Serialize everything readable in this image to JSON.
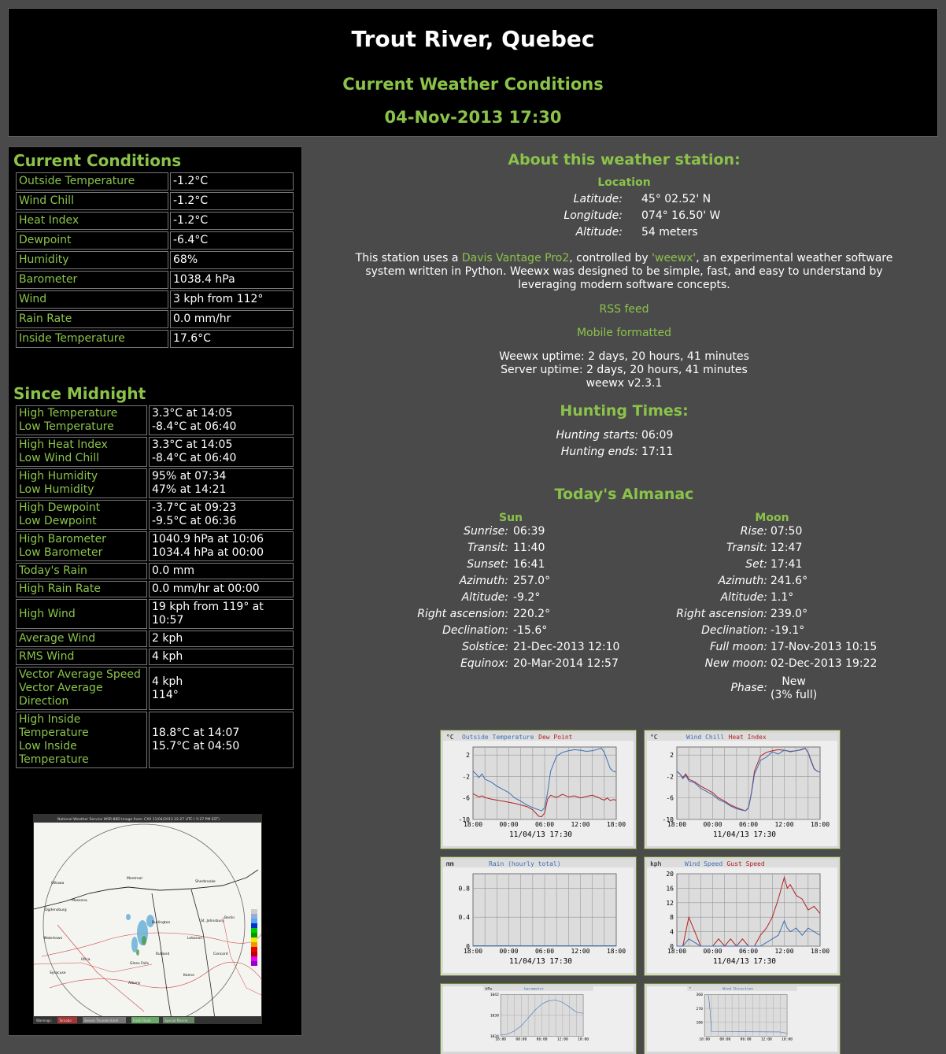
{
  "header": {
    "title": "Trout River, Quebec",
    "subtitle": "Current Weather Conditions",
    "time": "04-Nov-2013 17:30"
  },
  "current": {
    "title": "Current Conditions",
    "rows": [
      {
        "label": "Outside Temperature",
        "value": "-1.2°C"
      },
      {
        "label": "Wind Chill",
        "value": "-1.2°C"
      },
      {
        "label": "Heat Index",
        "value": "-1.2°C"
      },
      {
        "label": "Dewpoint",
        "value": "-6.4°C"
      },
      {
        "label": "Humidity",
        "value": "68%"
      },
      {
        "label": "Barometer",
        "value": "1038.4 hPa"
      },
      {
        "label": "Wind",
        "value": "3 kph from 112°"
      },
      {
        "label": "Rain Rate",
        "value": "0.0 mm/hr"
      },
      {
        "label": "Inside Temperature",
        "value": "17.6°C"
      }
    ]
  },
  "since": {
    "title": "Since Midnight",
    "rows": [
      {
        "l1": "High Temperature",
        "l2": "Low Temperature",
        "v1": "3.3°C at 14:05",
        "v2": "-8.4°C at 06:40"
      },
      {
        "l1": "High Heat Index",
        "l2": "Low Wind Chill",
        "v1": "3.3°C at 14:05",
        "v2": "-8.4°C at 06:40"
      },
      {
        "l1": "High Humidity",
        "l2": "Low Humidity",
        "v1": "95% at 07:34",
        "v2": "47% at 14:21"
      },
      {
        "l1": "High Dewpoint",
        "l2": "Low Dewpoint",
        "v1": "-3.7°C at 09:23",
        "v2": "-9.5°C at 06:36"
      },
      {
        "l1": "High Barometer",
        "l2": "Low Barometer",
        "v1": "1040.9 hPa at 10:06",
        "v2": "1034.4 hPa at 00:00"
      },
      {
        "l1": "Today's Rain",
        "v1": "0.0 mm"
      },
      {
        "l1": "High Rain Rate",
        "v1": "0.0 mm/hr at 00:00"
      },
      {
        "l1": "High Wind",
        "v1": "19 kph from 119° at",
        "v2": "10:57"
      },
      {
        "l1": "Average Wind",
        "v1": "2 kph"
      },
      {
        "l1": "RMS Wind",
        "v1": "4 kph"
      },
      {
        "l1": "Vector Average Speed",
        "l2": "Vector Average",
        "l3": "Direction",
        "v1": "4 kph",
        "v2": "114°"
      },
      {
        "l1": "High Inside",
        "l2": "Temperature",
        "l3": "Low Inside Temperature",
        "v1": "18.8°C at 14:07",
        "v2": "15.7°C at 04:50"
      }
    ]
  },
  "radar": {
    "caption": "National Weather Service WSR-88D Image from: CXX 11/04/2013 22:27 UTC ( 5:27 PM EST)",
    "legend": [
      "Warnings:",
      "Tornado",
      "Severe Thunderstorm",
      "Flash Flood",
      "Special Marine"
    ],
    "places": [
      "Montreal",
      "Ottawa",
      "Sherbrooke",
      "Massena",
      "Burlington",
      "Ogdensburg",
      "Watertown",
      "Glens Falls",
      "Rutland",
      "Lebanon",
      "Concord",
      "Albany",
      "Keene",
      "Syracuse",
      "Utica",
      "St. Johnsbury",
      "Berlin"
    ]
  },
  "about": {
    "title": "About this weather station:",
    "location_title": "Location",
    "latitude_label": "Latitude:",
    "latitude": "45° 02.52' N",
    "longitude_label": "Longitude:",
    "longitude": "074° 16.50' W",
    "altitude_label": "Altitude:",
    "altitude": "54 meters",
    "desc_1": "This station uses a ",
    "link_davis": "Davis Vantage Pro2",
    "desc_2": ", controlled by ",
    "link_weewx": "'weewx'",
    "desc_3": ", an experimental weather software",
    "desc_line2": "system written in Python. Weewx was designed to be simple, fast, and easy to understand by",
    "desc_line3": "leveraging modern software concepts.",
    "rss": "RSS feed",
    "mobile": "Mobile formatted",
    "weewx_uptime": "Weewx uptime: 2 days, 20 hours, 41 minutes",
    "server_uptime": "Server uptime: 2 days, 20 hours, 41 minutes",
    "version": "weewx v2.3.1"
  },
  "hunting": {
    "title": "Hunting Times:",
    "start_label": "Hunting starts:",
    "start": "06:09",
    "end_label": "Hunting ends:",
    "end": "17:11"
  },
  "almanac": {
    "title": "Today's Almanac",
    "sun_title": "Sun",
    "moon_title": "Moon",
    "sun": [
      {
        "k": "Sunrise:",
        "v": "06:39"
      },
      {
        "k": "Transit:",
        "v": "11:40"
      },
      {
        "k": "Sunset:",
        "v": "16:41"
      },
      {
        "k": "Azimuth:",
        "v": "257.0°"
      },
      {
        "k": "Altitude:",
        "v": "-9.2°"
      },
      {
        "k": "Right ascension:",
        "v": "220.2°"
      },
      {
        "k": "Declination:",
        "v": "-15.6°"
      },
      {
        "k": "Solstice:",
        "v": "21-Dec-2013 12:10"
      },
      {
        "k": "Equinox:",
        "v": "20-Mar-2014 12:57"
      }
    ],
    "moon": [
      {
        "k": "Rise:",
        "v": "07:50"
      },
      {
        "k": "Transit:",
        "v": "12:47"
      },
      {
        "k": "Set:",
        "v": "17:41"
      },
      {
        "k": "Azimuth:",
        "v": "241.6°"
      },
      {
        "k": "Altitude:",
        "v": "1.1°"
      },
      {
        "k": "Right ascension:",
        "v": "239.0°"
      },
      {
        "k": "Declination:",
        "v": "-19.1°"
      },
      {
        "k": "Full moon:",
        "v": "17-Nov-2013 10:15"
      },
      {
        "k": "New moon:",
        "v": "02-Dec-2013 19:22"
      }
    ],
    "phase_label": "Phase:",
    "phase_1": "New",
    "phase_2": "(3% full)"
  },
  "colors": {
    "accent": "#8bc34a",
    "background": "#4a4a4a",
    "panel": "#000000",
    "series_blue": "#3b6fb6",
    "series_red": "#b22222"
  },
  "chart_data": [
    {
      "type": "line",
      "unit": "°C",
      "series_names": [
        "Outside Temperature",
        "Dew Point"
      ],
      "xticks": [
        "18:00",
        "00:00",
        "06:00",
        "12:00",
        "18:00"
      ],
      "xlabel": "11/04/13 17:30",
      "yticks": [
        2,
        -2,
        -6,
        -10
      ],
      "ylim": [
        -10,
        3.5
      ],
      "x": [
        0,
        0.5,
        1,
        1.5,
        2,
        3,
        4,
        5,
        6,
        7,
        8,
        9,
        10,
        11,
        11.5,
        12,
        12.5,
        13,
        14,
        15,
        16,
        17,
        18,
        19,
        20,
        21,
        21.5,
        22,
        22.5,
        23,
        23.5,
        24
      ],
      "series": [
        {
          "name": "Outside Temperature",
          "color": "blue",
          "values": [
            -1,
            -1.5,
            -2.2,
            -1.5,
            -2.5,
            -3,
            -3.8,
            -4.4,
            -5,
            -6,
            -6.6,
            -7.3,
            -7.8,
            -8.2,
            -8.4,
            -7.8,
            -5,
            -1,
            1.8,
            2.5,
            2.8,
            3,
            2.9,
            2.7,
            2.8,
            3.1,
            3.3,
            2.5,
            1,
            -0.5,
            -1,
            -1.2
          ]
        },
        {
          "name": "Dew Point",
          "color": "red",
          "values": [
            -5.2,
            -5.5,
            -5.8,
            -5.6,
            -5.9,
            -6.2,
            -6.4,
            -6.6,
            -6.8,
            -7,
            -7.3,
            -7.6,
            -8.2,
            -9.4,
            -9.5,
            -8.8,
            -6.2,
            -5.5,
            -5.9,
            -5.3,
            -5.8,
            -5.6,
            -6,
            -5.7,
            -5.5,
            -5.9,
            -6.2,
            -6.4,
            -6.0,
            -6.5,
            -6.3,
            -6.4
          ]
        }
      ]
    },
    {
      "type": "line",
      "unit": "°C",
      "series_names": [
        "Wind Chill",
        "Heat Index"
      ],
      "xticks": [
        "18:00",
        "00:00",
        "06:00",
        "12:00",
        "18:00"
      ],
      "xlabel": "11/04/13 17:30",
      "yticks": [
        2,
        -2,
        -6,
        -10
      ],
      "ylim": [
        -10,
        3.5
      ],
      "x": [
        0,
        0.5,
        1,
        1.5,
        2,
        3,
        4,
        5,
        6,
        7,
        8,
        9,
        10,
        11,
        11.5,
        12,
        12.5,
        13,
        14,
        15,
        16,
        17,
        18,
        19,
        20,
        21,
        21.5,
        22,
        22.5,
        23,
        23.5,
        24
      ],
      "series": [
        {
          "name": "Heat Index",
          "color": "red",
          "values": [
            -1,
            -1.5,
            -2.2,
            -1.5,
            -2.5,
            -3,
            -3.8,
            -4.4,
            -5,
            -6,
            -6.6,
            -7.3,
            -7.8,
            -8.2,
            -8.4,
            -7.8,
            -5,
            -1,
            1.8,
            2.5,
            2.8,
            3,
            2.9,
            2.7,
            2.8,
            3.1,
            3.3,
            2.5,
            1,
            -0.5,
            -1,
            -1.2
          ]
        },
        {
          "name": "Wind Chill",
          "color": "blue",
          "values": [
            -1,
            -1.5,
            -2.4,
            -1.8,
            -2.8,
            -3.2,
            -4.2,
            -4.8,
            -5.4,
            -6.3,
            -6.8,
            -7.5,
            -8,
            -8.3,
            -8.4,
            -7.9,
            -5.2,
            -1.6,
            1,
            1.6,
            2.6,
            2.2,
            2.9,
            2.6,
            2.8,
            3.0,
            3.3,
            2.4,
            0.8,
            -0.6,
            -1,
            -1.2
          ]
        }
      ]
    },
    {
      "type": "bar",
      "unit": "mm",
      "series_names": [
        "Rain (hourly total)"
      ],
      "xticks": [
        "18:00",
        "00:00",
        "06:00",
        "12:00",
        "18:00"
      ],
      "xlabel": "11/04/13 17:30",
      "yticks": [
        0.8,
        0.4,
        0.0
      ],
      "ylim": [
        0,
        1.0
      ],
      "x": [
        0,
        24
      ],
      "series": [
        {
          "name": "Rain (hourly total)",
          "color": "blue",
          "values": [
            0,
            0
          ]
        }
      ]
    },
    {
      "type": "line",
      "unit": "kph",
      "series_names": [
        "Wind Speed",
        "Gust Speed"
      ],
      "xticks": [
        "18:00",
        "00:00",
        "06:00",
        "12:00",
        "18:00"
      ],
      "xlabel": "11/04/13 17:30",
      "yticks": [
        20,
        16,
        12,
        8,
        4,
        0
      ],
      "ylim": [
        0,
        20
      ],
      "x": [
        0,
        0.5,
        1,
        1.5,
        2,
        3,
        4,
        5,
        6,
        7,
        8,
        9,
        10,
        11,
        12,
        13,
        14,
        15,
        16,
        17,
        18,
        18.5,
        19,
        20,
        21,
        22,
        23,
        24
      ],
      "series": [
        {
          "name": "Gust Speed",
          "color": "red",
          "values": [
            0,
            0,
            0,
            4,
            8,
            4,
            0,
            0,
            0,
            2,
            0,
            2,
            0,
            2,
            0,
            0,
            3,
            5,
            8,
            13,
            19,
            16,
            17,
            14,
            13,
            10,
            11,
            9
          ]
        },
        {
          "name": "Wind Speed",
          "color": "blue",
          "values": [
            0,
            0,
            0,
            1,
            2,
            1,
            0,
            0,
            0,
            0,
            0,
            0,
            0,
            0,
            0,
            0,
            0,
            1,
            2,
            3,
            7,
            5,
            4,
            5,
            3,
            5,
            4,
            3
          ]
        }
      ]
    },
    {
      "type": "line",
      "unit": "hPa",
      "series_names": [
        "barometer"
      ],
      "xticks": [
        "18:00",
        "00:00",
        "06:00",
        "12:00",
        "18:00"
      ],
      "yticks": [
        1042,
        1038,
        1034
      ],
      "ylim": [
        1034,
        1042
      ],
      "x": [
        0,
        2,
        4,
        6,
        8,
        10,
        12,
        14,
        16,
        18,
        20,
        22,
        24
      ],
      "series": [
        {
          "name": "barometer",
          "color": "blue",
          "values": [
            1034.2,
            1034.4,
            1035,
            1036,
            1037.5,
            1039,
            1040.2,
            1040.8,
            1040.9,
            1040.5,
            1039.6,
            1038.6,
            1038.4
          ]
        }
      ]
    },
    {
      "type": "scatter",
      "unit": "°",
      "series_names": [
        "Wind Direction"
      ],
      "xticks": [
        "18:00",
        "00:00",
        "06:00",
        "12:00",
        "18:00"
      ],
      "yticks": [
        360,
        270,
        180
      ],
      "ylim": [
        90,
        360
      ],
      "x": [
        1,
        1.2,
        1.4,
        1.6,
        1.8,
        2,
        22,
        22.5,
        23,
        23.5,
        24
      ],
      "series": [
        {
          "name": "Wind Direction",
          "color": "blue",
          "values": [
            355,
            350,
            300,
            260,
            200,
            120,
            118,
            112,
            115,
            110,
            112
          ]
        }
      ]
    }
  ]
}
